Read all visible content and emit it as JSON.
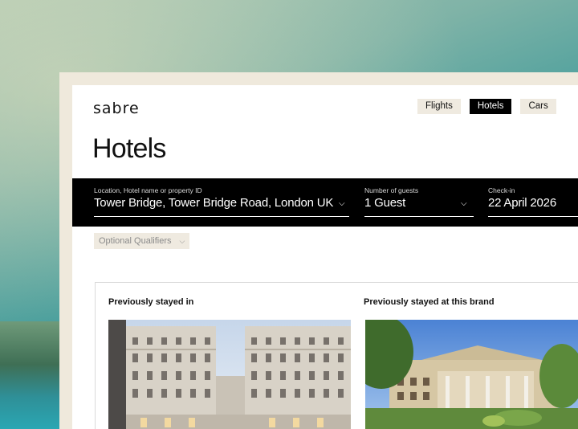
{
  "brand": {
    "logo_text": "sabre"
  },
  "nav": {
    "tabs": [
      {
        "label": "Flights",
        "active": false
      },
      {
        "label": "Hotels",
        "active": true
      },
      {
        "label": "Cars",
        "active": false
      }
    ]
  },
  "page": {
    "title": "Hotels"
  },
  "search": {
    "location": {
      "label": "Location, Hotel name or property ID",
      "value": "Tower Bridge, Tower Bridge Road, London UK"
    },
    "guests": {
      "label": "Number of guests",
      "value": "1 Guest"
    },
    "checkin": {
      "label": "Check-in",
      "value": "22 April 2026"
    }
  },
  "qualifiers": {
    "label": "Optional Qualifiers"
  },
  "history": {
    "previously_stayed": "Previously stayed in",
    "previously_brand": "Previously stayed at this brand"
  },
  "colors": {
    "bar": "#000000",
    "tab_bg": "#efeae0",
    "frame": "#efe9dc"
  }
}
